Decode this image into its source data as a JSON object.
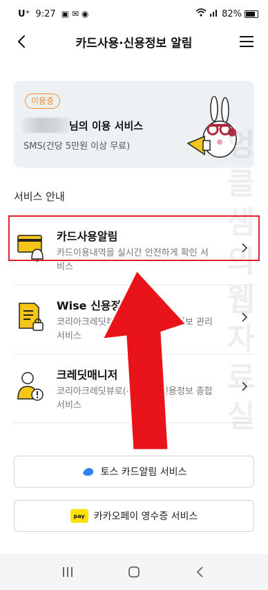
{
  "status_bar": {
    "carrier": "U⁺",
    "time": "9:27",
    "battery": "82%"
  },
  "header": {
    "title": "카드사용·신용정보 알림"
  },
  "subscription_card": {
    "badge": "이용중",
    "user_text": "님의 이용 서비스",
    "sub_text": "SMS(건당 5만원 이상 무료)"
  },
  "section_label": "서비스 안내",
  "services": [
    {
      "title": "카드사용알림",
      "desc": "카드이용내역을 실시간 안전하게 확인 서비스"
    },
    {
      "title": "Wise 신용정보",
      "desc": "코리아크레딧뷰로(주) 제공 신용정보 관리서비스"
    },
    {
      "title": "크레딧매니저",
      "desc": "코리아크레딧뷰로(주) 제공 신용정보 종합서비스"
    }
  ],
  "buttons": {
    "toss": "토스 카드알림 서비스",
    "kakaopay": "카카오페이 영수증 서비스",
    "kakaopay_logo": "pay"
  },
  "watermark": "엉클샘의웹자료실",
  "colors": {
    "accent_orange": "#f08a2c",
    "highlight_red": "#e3202a",
    "icon_yellow": "#f5c518",
    "kakao_yellow": "#ffe300",
    "toss_blue": "#3182f6"
  }
}
